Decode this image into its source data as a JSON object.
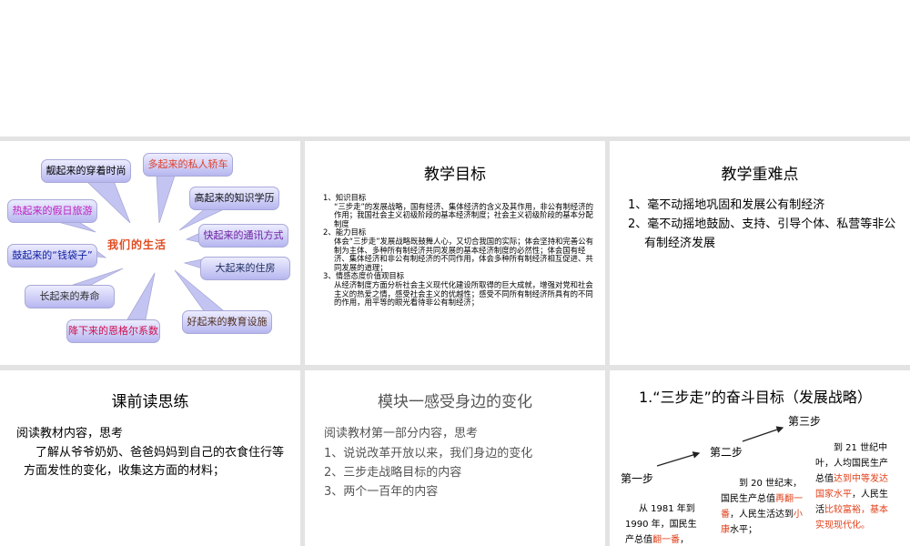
{
  "slide1": {
    "center": "我们的生活",
    "bubbles": [
      "靓起来的穿着时尚",
      "多起来的私人轿车",
      "高起来的知识学历",
      "热起来的假日旅游",
      "快起来的通讯方式",
      "鼓起来的“钱袋子”",
      "大起来的住房",
      "长起来的寿命",
      "降下来的恩格尔系数",
      "好起来的教育设施"
    ],
    "colors": [
      "#555555",
      "#e0402a",
      "#111111",
      "#c020c0",
      "#7020a0",
      "#1020a0",
      "#203060",
      "#333333",
      "#d01050",
      "#503020"
    ]
  },
  "slide2": {
    "title": "教学目标",
    "h1": "1、知识目标",
    "t1": "“三步走”的发展战略，国有经济、集体经济的含义及其作用，非公有制经济的作用；我国社会主义初级阶段的基本经济制度；社会主义初级阶段的基本分配制度",
    "h2": "2、能力目标",
    "t2": "体会“三步走”发展战略既鼓舞人心，又切合我国的实际；体会坚持和完善公有制为主体、多种所有制经济共同发展的基本经济制度的必然性；体会国有经济、集体经济和非公有制经济的不同作用，体会多种所有制经济相互促进、共同发展的道理；",
    "h3": "3、情感态度价值观目标",
    "t3": "从经济制度方面分析社会主义现代化建设所取得的巨大成就，增强对党和社会主义的热爱之情，感受社会主义的优越性；感受不同所有制经济所具有的不同的作用，用平等的眼光看待非公有制经济；"
  },
  "slide3": {
    "title": "教学重难点",
    "points": [
      "1、毫不动摇地巩固和发展公有制经济",
      "2、毫不动摇地鼓励、支持、引导个体、私营等非公有制经济发展"
    ]
  },
  "slide4": {
    "title": "课前读思练",
    "intro": "阅读教材内容，思考",
    "body": "了解从爷爷奶奶、爸爸妈妈到自己的衣食住行等方面发性的变化，收集这方面的材料；"
  },
  "slide5": {
    "title": "模块一感受身边的变化",
    "intro": "阅读教材第一部分内容，思考",
    "items": [
      "1、说说改革开放以来，我们身边的变化",
      "2、三步走战略目标的内容",
      "3、两个一百年的内容"
    ]
  },
  "slide6": {
    "title": "1.“三步走”的奋斗目标（发展战略）",
    "steps": [
      "第一步",
      "第二步",
      "第三步"
    ],
    "s1": {
      "a": "从 1981 年到 1990 年，国民生产总值",
      "b": "翻一番",
      "c": "，"
    },
    "s2": {
      "a": "到 20 世纪末，国民生产总值",
      "b": "再翻一番",
      "c": "，人民生活达到",
      "d": "小康",
      "e": "水平；"
    },
    "s3": {
      "a": "到 21 世纪中叶，人均国民生产总值",
      "b": "达到中等发达国家水平",
      "c": "，人民生活",
      "d": "比较富裕，基本实现现代化。"
    }
  }
}
